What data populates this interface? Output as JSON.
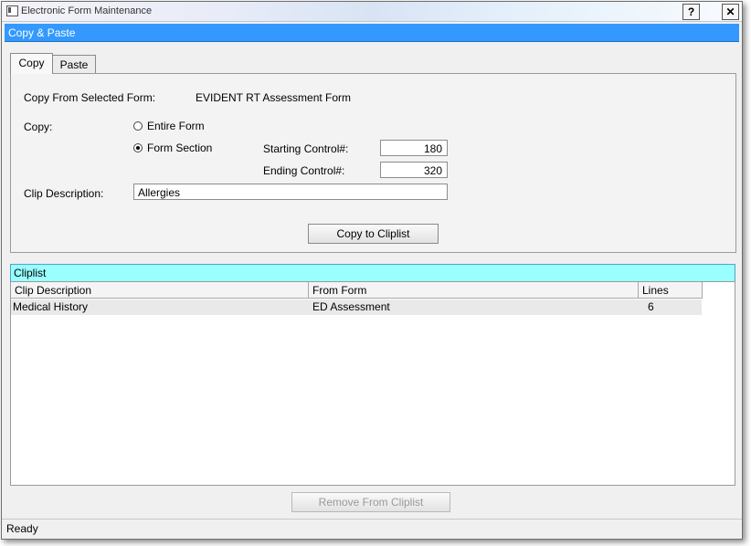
{
  "window": {
    "title": "Electronic Form Maintenance",
    "help_button": "?",
    "close_button": "✕"
  },
  "panel": {
    "title": "Copy & Paste"
  },
  "tabs": [
    {
      "label": "Copy"
    },
    {
      "label": "Paste"
    }
  ],
  "copy": {
    "from_label": "Copy From Selected Form:",
    "from_value": "EVIDENT RT Assessment Form",
    "copy_label": "Copy:",
    "option_entire": "Entire Form",
    "option_section": "Form Section",
    "selected_option": "Form Section",
    "starting_label": "Starting Control#:",
    "starting_value": "180",
    "ending_label": "Ending Control#:",
    "ending_value": "320",
    "clip_desc_label": "Clip Description:",
    "clip_desc_value": "Allergies",
    "copy_button": "Copy to Cliplist"
  },
  "cliplist": {
    "title": "Cliplist",
    "columns": [
      "Clip Description",
      "From Form",
      "Lines"
    ],
    "rows": [
      {
        "description": "Medical History",
        "from_form": "ED Assessment",
        "lines": "6"
      }
    ],
    "remove_button": "Remove From Cliplist"
  },
  "status": {
    "text": "Ready"
  }
}
